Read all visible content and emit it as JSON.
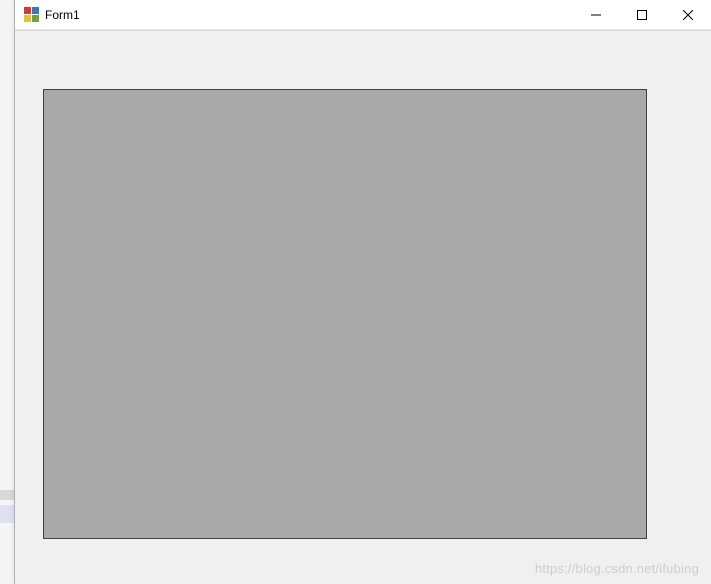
{
  "window": {
    "title": "Form1"
  },
  "watermark": "https://blog.csdn.net/ifubing"
}
